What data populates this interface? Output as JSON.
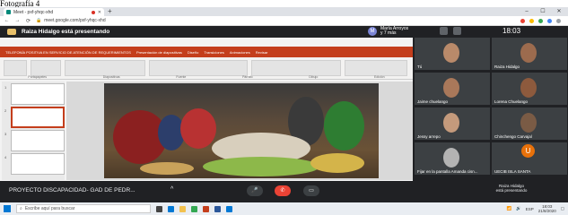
{
  "caption": "Fotografía 4",
  "browser": {
    "tab_title": "Meet - pxf-yhqc-xhd",
    "url": "meet.google.com/pxf-yhqc-xhd",
    "new_tab": "+",
    "min": "–",
    "max": "☐",
    "close": "✕",
    "back": "←",
    "forward": "→",
    "reload": "⟳"
  },
  "meet": {
    "presenting_title": "Raiza Hidalgo está presentando",
    "self_name_line1": "María Arroyos",
    "self_name_line2": "y 7 más",
    "self_initial": "M",
    "time": "18:03",
    "meeting_name": "PROYECTO DISCAPACIDAD- GAD DE PEDR...",
    "chevron": "^",
    "presenter_line1": "Raiza Hidalgo",
    "presenter_line2": "está presentando"
  },
  "ppt": {
    "ribbon_top": [
      "TELEFONÍA POSITIVA EN SERVICIO DE ATENCIÓN DE REQUERIMIENTOS",
      "Presentación de diapositivas",
      "Diseño",
      "Transiciones",
      "Animaciones",
      "Revisar"
    ],
    "ribbon_labels": [
      "Portapapeles",
      "Diapositivas",
      "Fuente",
      "Párrafo",
      "Dibujo",
      "Edición"
    ],
    "slide_numbers": [
      "1",
      "2",
      "3",
      "4"
    ]
  },
  "participants": [
    {
      "name": "Tú"
    },
    {
      "name": "Raiza Hidalgo"
    },
    {
      "name": "Jaime chuelango"
    },
    {
      "name": "Lorena Chuelango"
    },
    {
      "name": "Jessy arrepo"
    },
    {
      "name": "Chinchengo Carvajal"
    },
    {
      "name": "Fijar en la pantalla    Amanda cisn..."
    },
    {
      "name": "UECIB ISLA SANTA"
    }
  ],
  "participant_initial": "U",
  "taskbar": {
    "search_placeholder": "Escribe aquí para buscar",
    "tray_lang": "ESP",
    "clock_time": "18:03",
    "clock_date": "21/8/2020"
  }
}
